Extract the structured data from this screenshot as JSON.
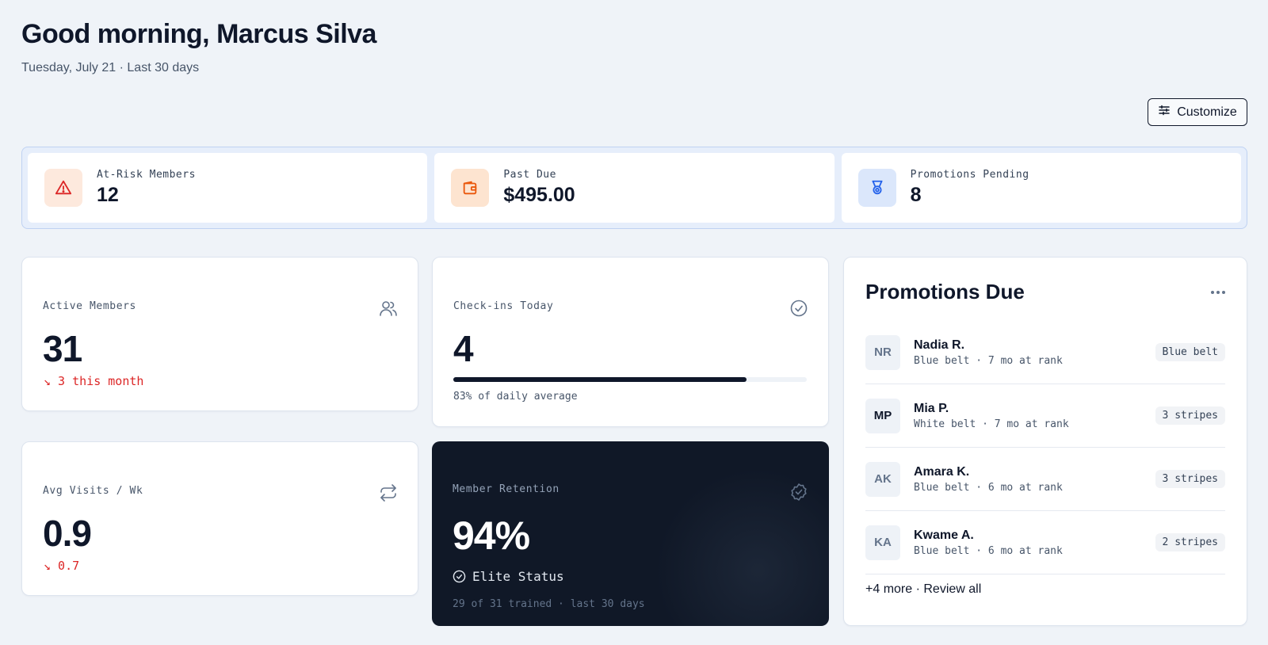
{
  "header": {
    "greeting": "Good morning, Marcus Silva",
    "subline": "Tuesday, July 21 · Last 30 days"
  },
  "toolbar": {
    "customize_label": "Customize"
  },
  "alerts": [
    {
      "label": "At-Risk Members",
      "value": "12",
      "icon": "warning-triangle-icon",
      "color": "#dc2626",
      "bg": "#fde9dd"
    },
    {
      "label": "Past Due",
      "value": "$495.00",
      "icon": "wallet-icon",
      "color": "#ea580c",
      "bg": "#fde4d0"
    },
    {
      "label": "Promotions Pending",
      "value": "8",
      "icon": "medal-icon",
      "color": "#2563eb",
      "bg": "#dbe7fb"
    }
  ],
  "stats": {
    "active_members": {
      "label": "Active Members",
      "value": "31",
      "delta": "↘ 3 this month"
    },
    "checkins_today": {
      "label": "Check-ins Today",
      "value": "4",
      "progress_fraction": 0.83,
      "caption": "83% of daily average"
    },
    "avg_visits": {
      "label": "Avg Visits / Wk",
      "value": "0.9",
      "delta": "↘ 0.7"
    },
    "retention": {
      "label": "Member Retention",
      "value": "94%",
      "status": "Elite Status",
      "caption": "29 of 31 trained · last 30 days"
    }
  },
  "promotions": {
    "title": "Promotions Due",
    "items": [
      {
        "initials": "NR",
        "name": "Nadia R.",
        "meta": "Blue belt · 7 mo at rank",
        "tag": "Blue belt"
      },
      {
        "initials": "MP",
        "name": "Mia P.",
        "meta": "White belt · 7 mo at rank",
        "tag": "3 stripes"
      },
      {
        "initials": "AK",
        "name": "Amara K.",
        "meta": "Blue belt · 6 mo at rank",
        "tag": "3 stripes"
      },
      {
        "initials": "KA",
        "name": "Kwame A.",
        "meta": "Blue belt · 6 mo at rank",
        "tag": "2 stripes"
      }
    ],
    "footer": "+4 more · Review all"
  }
}
